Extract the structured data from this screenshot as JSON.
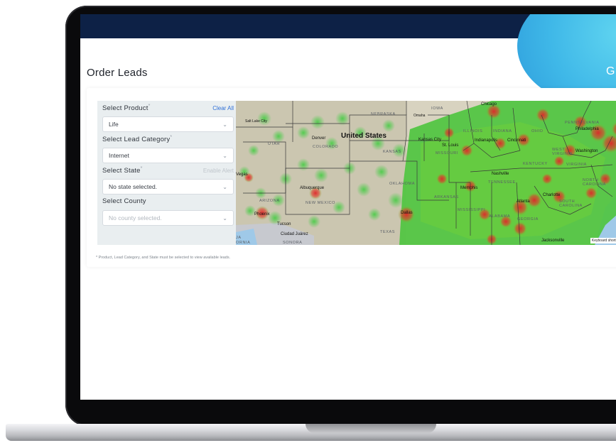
{
  "topbar": {
    "cart_icon": "cart-icon",
    "separator": "|",
    "alert_icon": "alert-icon",
    "cut_text": "("
  },
  "header": {
    "title": "Order Leads",
    "promo_text": "G"
  },
  "filters": {
    "product": {
      "label": "Select Product",
      "required_mark": "*",
      "action": "Clear All",
      "value": "Life"
    },
    "lead_category": {
      "label": "Select Lead Category",
      "required_mark": "*",
      "value": "Internet"
    },
    "state": {
      "label": "Select State",
      "required_mark": "*",
      "action": "Enable Alert",
      "value": "No state selected."
    },
    "county": {
      "label": "Select County",
      "value": "No county selected."
    }
  },
  "map": {
    "labels": {
      "country": "United States",
      "nebraska": "NEBRASKA",
      "omaha": "Omaha",
      "iowa": "IOWA",
      "chicago": "Chicago",
      "salt_lake": "Salt Lake City",
      "utah": "UTAH",
      "denver": "Denver",
      "colorado": "COLORADO",
      "kansas": "KANSAS",
      "kansas_city": "Kansas City",
      "st_louis": "St. Louis",
      "missouri": "MISSOURI",
      "illinois": "ILLINOIS",
      "indiana": "INDIANA",
      "indianapolis": "Indianapolis",
      "cincinnati": "Cincinnati",
      "ohio": "OHIO",
      "pennsylvania": "PENNSYLVANIA",
      "philadelphia": "Philadelphia",
      "west_virginia": "WEST VIRGINIA",
      "washington": "Washington",
      "kentucky": "KENTUCKY",
      "virginia": "VIRGINIA",
      "vegas": "Vegas",
      "albuquerque": "Albuquerque",
      "oklahoma": "OKLAHOMA",
      "nashville": "Nashville",
      "tennessee": "TENNESSEE",
      "north_carolina": "NORTH CAROLINA",
      "arizona": "ARIZONA",
      "new_mexico": "NEW MEXICO",
      "memphis": "Memphis",
      "arkansas": "ARKANSAS",
      "phoenix": "Phoenix",
      "atlanta": "Atlanta",
      "charlotte": "Charlotte",
      "south_carolina": "SOUTH CAROLINA",
      "mississippi": "MISSISSIPPI",
      "alabama": "ALABAMA",
      "georgia": "GEORGIA",
      "tucson": "Tucson",
      "dallas": "Dallas",
      "texas": "TEXAS",
      "ciudad_juarez": "Ciudad Juárez",
      "jacksonville": "Jacksonville",
      "ornia": "ORNIA",
      "sonora": "SONORA",
      "ja": "JA"
    },
    "keyboard_shortcuts": "Keyboard shortcuts"
  },
  "footnote": "* Product, Lead Category, and State must be selected to view available leads.",
  "colors": {
    "topbar": "#0d2146",
    "link": "#2f6fd6",
    "heat_high": "#e0262a",
    "heat_low": "#3fcc3f"
  }
}
